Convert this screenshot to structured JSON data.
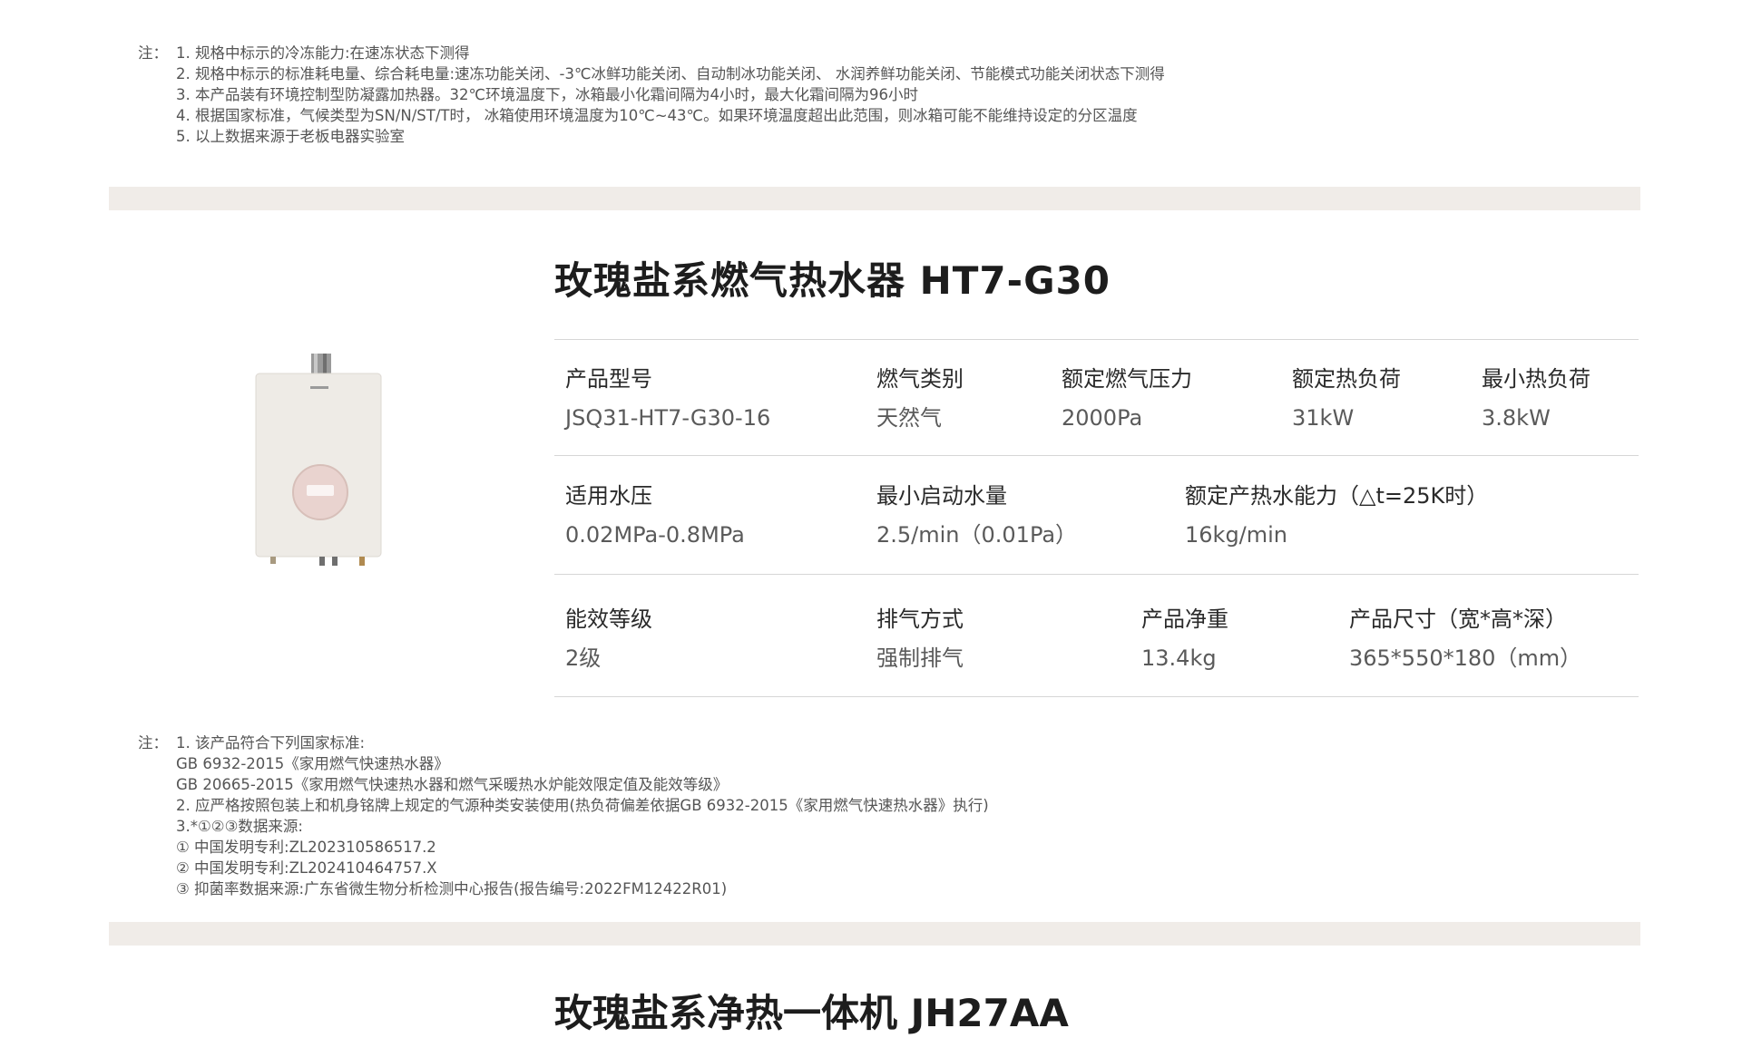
{
  "notes_top": {
    "label": "注：",
    "lines": [
      "1. 规格中标示的冷冻能力:在速冻状态下测得",
      "2. 规格中标示的标准耗电量、综合耗电量:速冻功能关闭、-3℃冰鲜功能关闭、自动制冰功能关闭、 水润养鲜功能关闭、节能模式功能关闭状态下测得",
      "3. 本产品装有环境控制型防凝露加热器。32℃环境温度下，冰箱最小化霜间隔为4小时，最大化霜间隔为96小时",
      "4. 根据国家标准，气候类型为SN/N/ST/T时，  冰箱使用环境温度为10℃~43℃。如果环境温度超出此范围，则冰箱可能不能维持设定的分区温度",
      "5. 以上数据来源于老板电器实验室"
    ]
  },
  "product": {
    "title": "玫瑰盐系燃气热水器 HT7-G30",
    "row1": [
      {
        "key": "产品型号",
        "value": "JSQ31-HT7-G30-16"
      },
      {
        "key": "燃气类别",
        "value": "天然气"
      },
      {
        "key": "额定燃气压力",
        "value": "2000Pa"
      },
      {
        "key": "额定热负荷",
        "value": "31kW"
      },
      {
        "key": "最小热负荷",
        "value": "3.8kW"
      }
    ],
    "row2": [
      {
        "key": "适用水压",
        "value": "0.02MPa-0.8MPa"
      },
      {
        "key": "最小启动水量",
        "value": "2.5/min（0.01Pa）"
      },
      {
        "key": "额定产热水能力（△t=25K时）",
        "value": "16kg/min"
      }
    ],
    "row3": [
      {
        "key": "能效等级",
        "value": "2级"
      },
      {
        "key": "排气方式",
        "value": "强制排气"
      },
      {
        "key": "产品净重",
        "value": "13.4kg"
      },
      {
        "key": "产品尺寸（宽*高*深）",
        "value": "365*550*180（mm）"
      }
    ]
  },
  "notes_mid": {
    "label": "注：",
    "lines": [
      "1. 该产品符合下列国家标准:",
      "GB 6932-2015《家用燃气快速热水器》",
      "GB 20665-2015《家用燃气快速热水器和燃气采暖热水炉能效限定值及能效等级》",
      "2. 应严格按照包装上和机身铭牌上规定的气源种类安装使用(热负荷偏差依据GB 6932-2015《家用燃气快速热水器》执行)",
      "3.*①②③数据来源:",
      "① 中国发明专利:ZL202310586517.2",
      "② 中国发明专利:ZL202410464757.X",
      "③ 抑菌率数据来源:广东省微生物分析检测中心报告(报告编号:2022FM12422R01)"
    ]
  },
  "next_product": {
    "title": "玫瑰盐系净热一体机 JH27AA"
  },
  "colors": {
    "band": "#f0ece8",
    "heater_body": "#eeebe6",
    "control_knob": "#e9d3cf"
  }
}
